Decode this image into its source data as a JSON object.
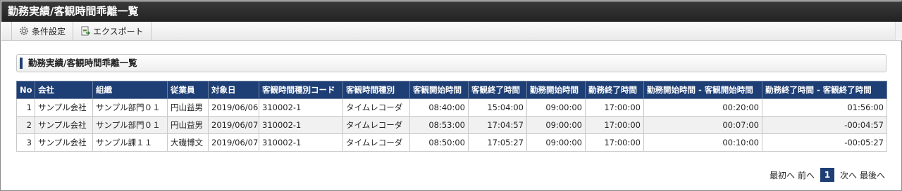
{
  "window": {
    "title": "勤務実績/客観時間乖離一覧"
  },
  "toolbar": {
    "condition_label": "条件設定",
    "export_label": "エクスポート"
  },
  "section": {
    "title": "勤務実績/客観時間乖離一覧"
  },
  "table": {
    "columns": [
      "No",
      "会社",
      "組織",
      "従業員",
      "対象日",
      "客観時間種別コード",
      "客観時間種別",
      "客観開始時間",
      "客観終了時間",
      "勤務開始時間",
      "勤務終了時間",
      "勤務開始時間 - 客観開始時間",
      "勤務終了時間 - 客観終了時間"
    ],
    "rows": [
      [
        "1",
        "サンプル会社",
        "サンプル部門０１",
        "円山益男",
        "2019/06/06",
        "310002-1",
        "タイムレコーダ",
        "08:40:00",
        "15:04:00",
        "09:00:00",
        "17:00:00",
        "00:20:00",
        "01:56:00"
      ],
      [
        "2",
        "サンプル会社",
        "サンプル部門０１",
        "円山益男",
        "2019/06/07",
        "310002-1",
        "タイムレコーダ",
        "08:53:00",
        "17:04:57",
        "09:00:00",
        "17:00:00",
        "00:07:00",
        "-00:04:57"
      ],
      [
        "3",
        "サンプル会社",
        "サンプル課１１",
        "大磯博文",
        "2019/06/07",
        "310002-1",
        "タイムレコーダ",
        "08:50:00",
        "17:05:27",
        "09:00:00",
        "17:00:00",
        "00:10:00",
        "-00:05:27"
      ]
    ]
  },
  "pager": {
    "first": "最初へ",
    "prev": "前へ",
    "current": "1",
    "next": "次へ",
    "last": "最後へ"
  },
  "colors": {
    "header_bg": "#1e3f75",
    "titlebar_bg": "#2b2b2b"
  },
  "icons": {
    "condition": "gear-icon",
    "export": "export-document-icon"
  }
}
